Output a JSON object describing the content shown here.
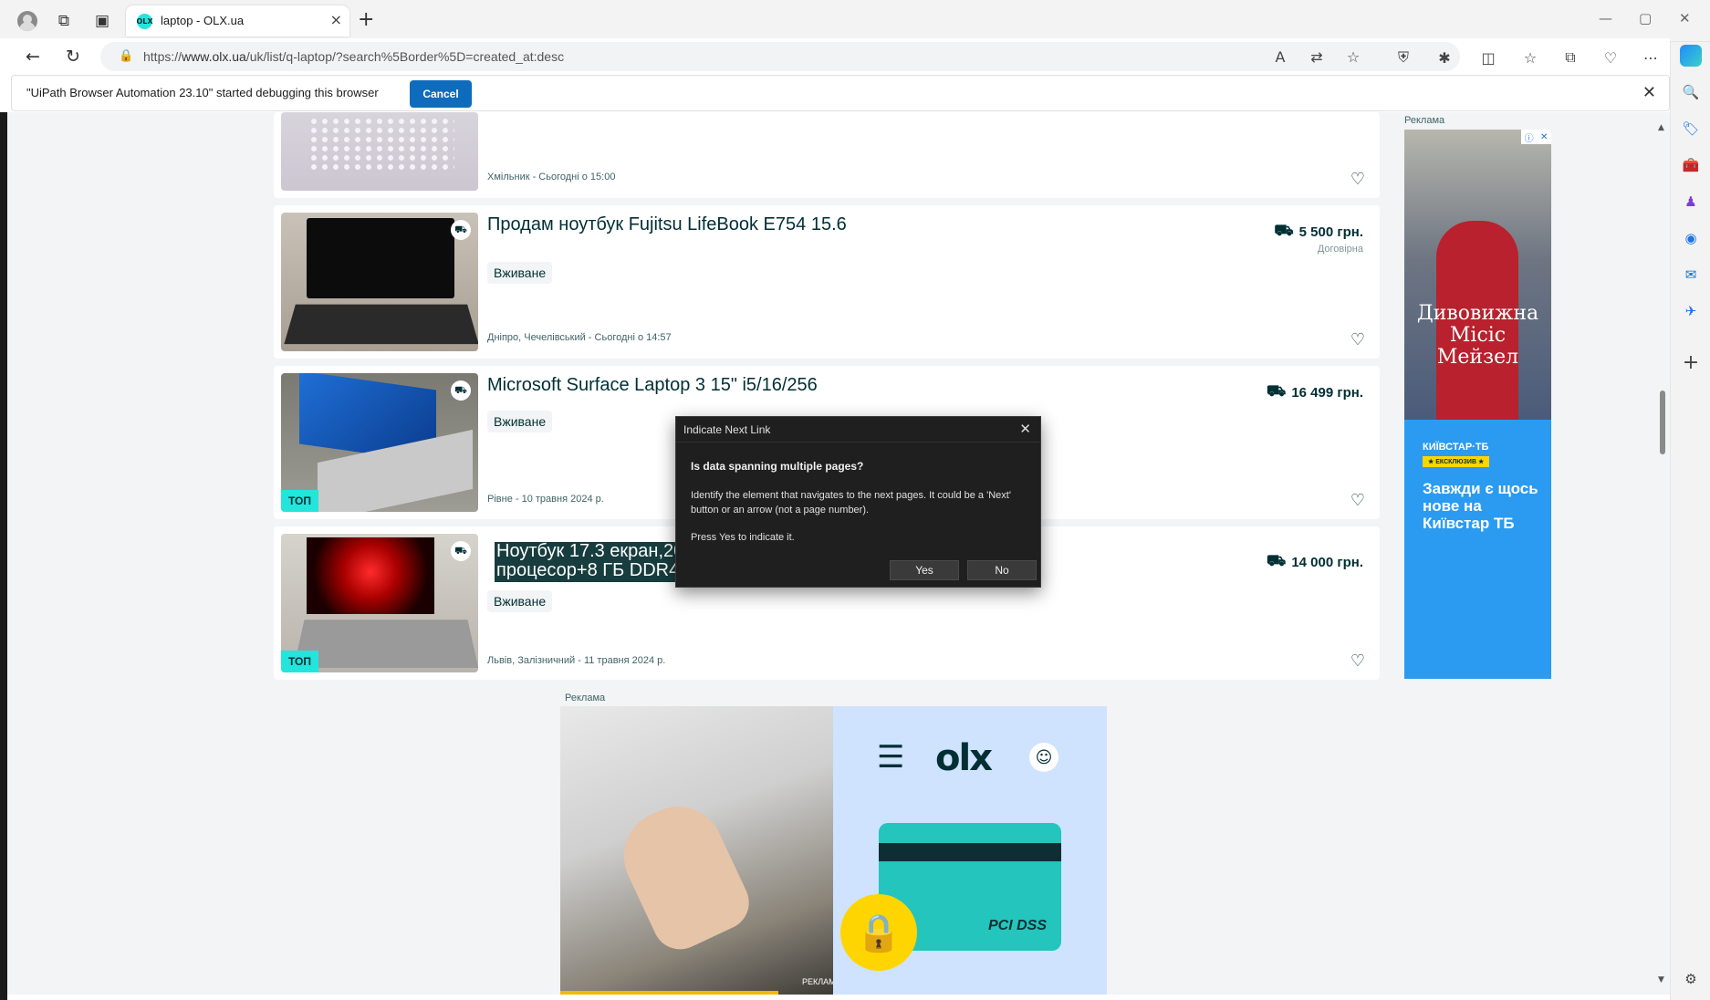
{
  "browser": {
    "tab_title": "laptop - OLX.ua",
    "tab_favicon": "OLX",
    "url_prefix": "https://",
    "url_domain": "www.olx.ua",
    "url_path": "/uk/list/q-laptop/?search%5Border%5D=created_at:desc",
    "icons": {
      "back": "←",
      "reload": "↻",
      "lock": "🔒",
      "new_tab": "+",
      "close_tab": "×",
      "minimize": "—",
      "maximize": "▢",
      "close_window": "✕",
      "read_aloud": "A",
      "translate": "⇄",
      "favorite": "☆",
      "shield": "⛨",
      "extensions": "✱",
      "split": "◫",
      "favorites_list": "☆",
      "collections": "⧉",
      "browser_essentials": "♡",
      "more": "⋯"
    }
  },
  "infobar": {
    "message": "\"UiPath Browser Automation 23.10\" started debugging this browser",
    "cancel_label": "Cancel",
    "close": "✕"
  },
  "sidebar": {
    "icons": [
      "🔍",
      "🏷",
      "🧰",
      "♟",
      "◉",
      "✉",
      "✈",
      "+",
      "⚙"
    ]
  },
  "listings": [
    {
      "title": "",
      "condition": "",
      "location": "Хмільник - Сьогодні о 15:00",
      "price": "",
      "price_note": "",
      "top": false
    },
    {
      "title": "Продам ноутбук Fujitsu LifeBook E754 15.6",
      "condition": "Вживане",
      "location": "Дніпро, Чечелівський - Сьогодні о 14:57",
      "price": "5 500 грн.",
      "price_note": "Договірна",
      "top": false
    },
    {
      "title": "Microsoft Surface Laptop 3 15\" i5/16/256",
      "condition": "Вживане",
      "location": "Рівне - 10 травня 2024 р.",
      "price": "16 499 грн.",
      "price_note": "",
      "top": true
    },
    {
      "title_line1": "Ноутбук 17.3 екран,20",
      "title_line2": "процесор+8 ГБ DDR4",
      "condition": "Вживане",
      "location": "Львів, Залізничний - 11 травня 2024 р.",
      "price": "14 000 грн.",
      "price_note": "",
      "top": true
    }
  ],
  "labels": {
    "top_badge": "ТОП",
    "ad_label": "Реклама",
    "heart": "♡",
    "truck": "⛟"
  },
  "right_ad": {
    "poster_title": "Дивовижна Місіс Мейзел",
    "kyivstar": "КИЇВСТАР·ТБ",
    "exclusive": "★ ЕКСКЛЮЗИВ ★",
    "promo": "Завжди є щось нове на Київстар ТБ",
    "adchoice_i": "ⓘ",
    "adchoice_x": "✕"
  },
  "bottom_ad": {
    "video_label": "РЕКЛАМА 0:46",
    "menu": "☰",
    "logo": "olx",
    "user": "☺",
    "pci": "PCI DSS",
    "padlock": "🔒",
    "video_progress": 0.8
  },
  "dialog": {
    "title": "Indicate Next Link",
    "close": "✕",
    "question": "Is data spanning multiple pages?",
    "body": "Identify the element that navigates to the next pages. It could be a 'Next' button or an arrow (not a page number).",
    "press": "Press Yes to indicate it.",
    "yes": "Yes",
    "no": "No"
  },
  "colors": {
    "olx_teal": "#23e5db",
    "olx_dark": "#002f34",
    "edge_blue": "#0f6cbd",
    "dialog_bg": "#1f1f1f"
  }
}
